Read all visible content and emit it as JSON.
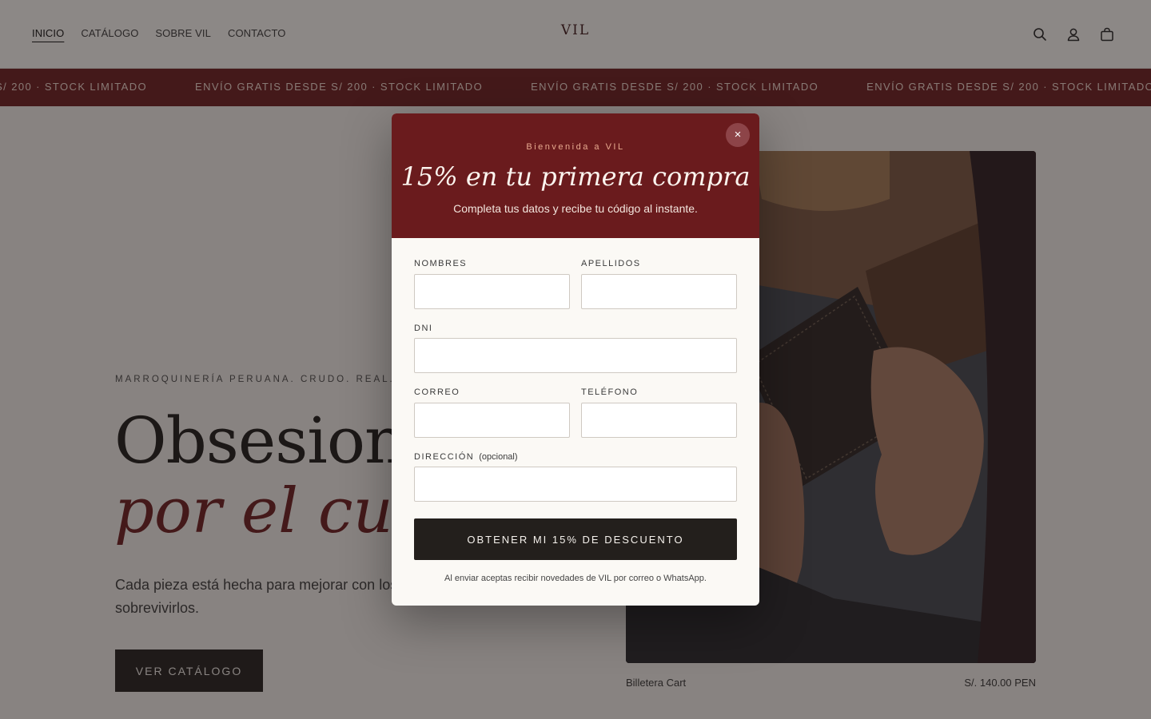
{
  "header": {
    "nav": [
      "INICIO",
      "CATÁLOGO",
      "SOBRE VIL",
      "CONTACTO"
    ],
    "logo": "VIL",
    "icons": [
      "search-icon",
      "user-icon",
      "bag-icon"
    ]
  },
  "marquee": {
    "items": [
      "ENVÍO GRATIS DESDE S/ 200 · STOCK LIMITADO",
      "ENVÍO GRATIS DESDE S/ 200 · STOCK LIMITADO",
      "ENVÍO GRATIS DESDE S/ 200 · STOCK LIMITADO",
      "ENVÍO GRATIS DESDE S/ 200 · STOCK LIMITADO"
    ]
  },
  "hero": {
    "eyebrow": "MARROQUINERÍA PERUANA. CRUDO. REAL. V",
    "title_line1": "Obsesiona",
    "title_line2": "por el cuero",
    "subtitle": "Cada pieza está hecha para mejorar con los años, no para sobrevivirlos.",
    "cta": "VER CATÁLOGO"
  },
  "product": {
    "name": "Billetera Cart",
    "price": "S/. 140.00 PEN"
  },
  "modal": {
    "eyebrow": "Bienvenida a VIL",
    "title": "15% en tu primera compra",
    "subtitle": "Completa tus datos y recibe tu código al instante.",
    "close": "×",
    "fields": {
      "nombres": "NOMBRES",
      "apellidos": "APELLIDOS",
      "dni": "DNI",
      "correo": "CORREO",
      "telefono": "TELÉFONO",
      "direccion": "DIRECCIÓN",
      "direccion_opt": "(opcional)"
    },
    "submit": "OBTENER MI 15% DE DESCUENTO",
    "legal": "Al enviar aceptas recibir novedades de VIL por correo o WhatsApp."
  }
}
